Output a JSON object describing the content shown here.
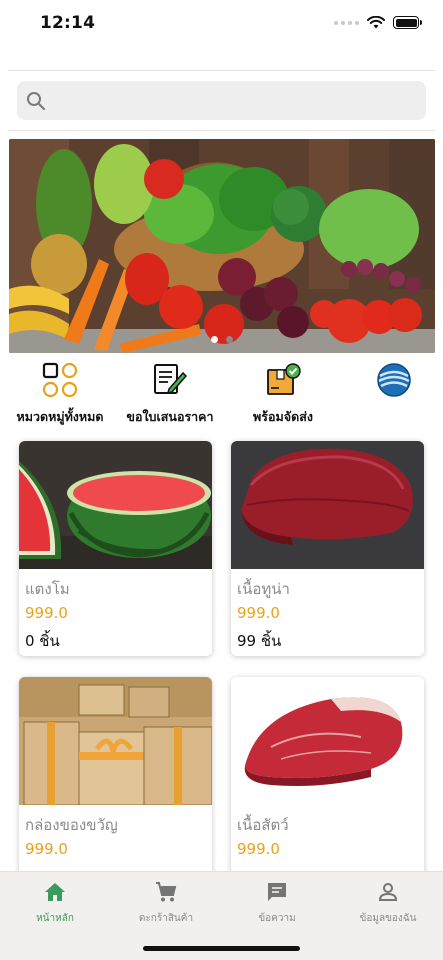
{
  "status_bar": {
    "time": "12:14"
  },
  "search": {
    "placeholder": "",
    "value": ""
  },
  "banner": {
    "slide_count": 2,
    "active_slide": 1,
    "dot_active_color": "#ffffff",
    "dot_inactive_color": "#8a8a8a"
  },
  "categories": [
    {
      "label": "หมวดหมู่ทั้งหมด",
      "icon": "grid-icon"
    },
    {
      "label": "ขอใบเสนอราคา",
      "icon": "quote-request-icon"
    },
    {
      "label": "พร้อมจัดส่ง",
      "icon": "ready-to-ship-icon"
    },
    {
      "label": "",
      "icon": "globe-icon"
    }
  ],
  "products": [
    {
      "name": "แตงโม",
      "price": "999.0",
      "qty": "0  ชิ้น",
      "image": "watermelon"
    },
    {
      "name": "เนื้อทูน่า",
      "price": "999.0",
      "qty": "99  ชิ้น",
      "image": "tuna"
    },
    {
      "name": "กล่องของขวัญ",
      "price": "999.0",
      "qty": "",
      "image": "gift-boxes"
    },
    {
      "name": "เนื้อสัตว์",
      "price": "999.0",
      "qty": "",
      "image": "beef"
    }
  ],
  "tabs": [
    {
      "label": "หน้าหลัก",
      "icon": "home-icon",
      "active": true
    },
    {
      "label": "ตะกร้าสินค้า",
      "icon": "cart-icon",
      "active": false
    },
    {
      "label": "ข้อความ",
      "icon": "message-icon",
      "active": false
    },
    {
      "label": "ข้อมูลของฉัน",
      "icon": "profile-icon",
      "active": false
    }
  ],
  "colors": {
    "accent": "#3c9a5a",
    "price": "#e8a21a",
    "muted_text": "#8a8a8a"
  }
}
